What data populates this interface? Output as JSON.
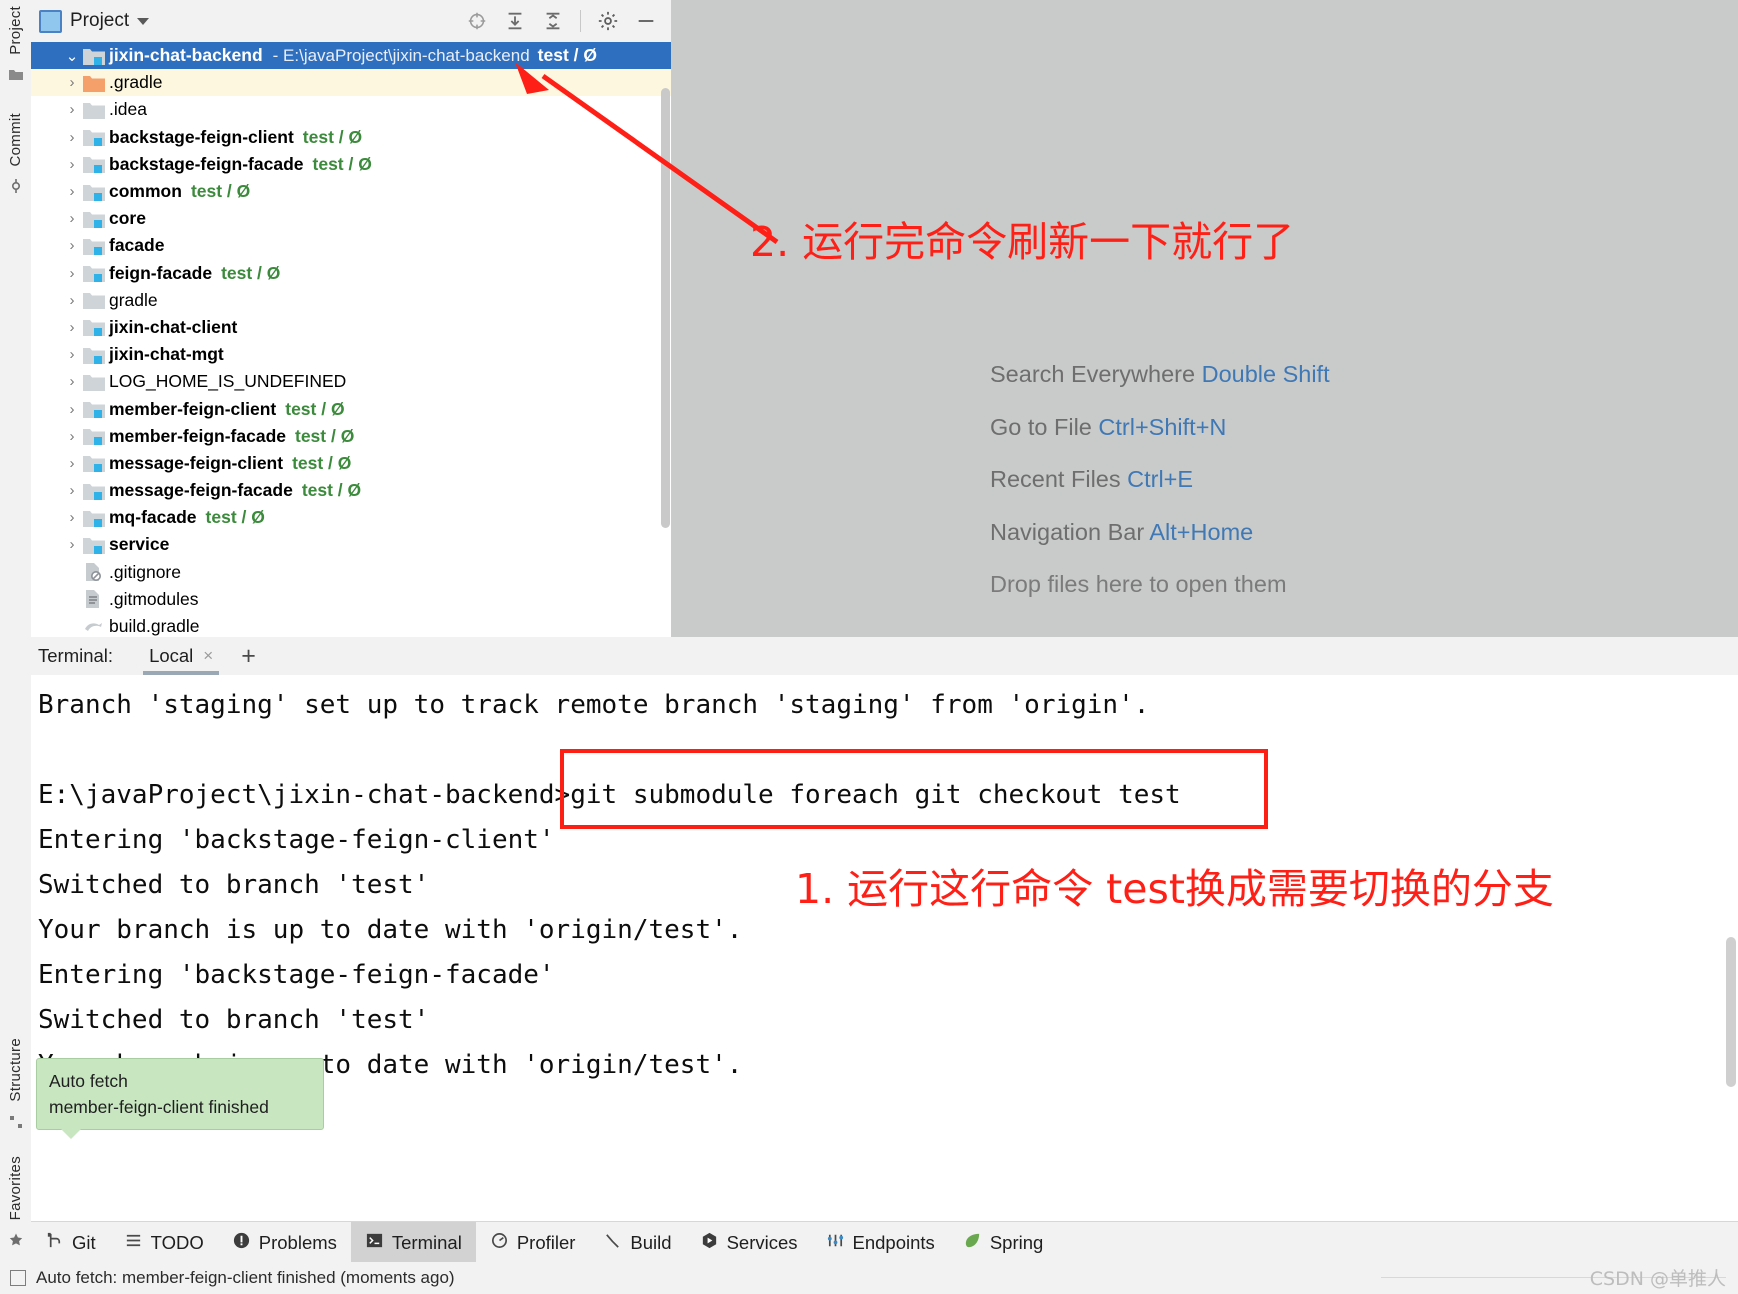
{
  "window": {
    "close_label": "×"
  },
  "left_strip": {
    "tabs": [
      {
        "label": "Project",
        "icon": "project-icon"
      },
      {
        "label": "Commit",
        "icon": "commit-icon"
      },
      {
        "label": "Structure",
        "icon": "structure-icon"
      },
      {
        "label": "Favorites",
        "icon": "star-icon"
      }
    ]
  },
  "project_panel": {
    "title": "Project",
    "icons": {
      "locate": "crosshair-icon",
      "expand_all": "expand-all-icon",
      "collapse_all": "collapse-all-icon",
      "settings": "gear-icon",
      "hide": "minimize-icon"
    },
    "root": {
      "name": "jixin-chat-backend",
      "path": "- E:\\javaProject\\jixin-chat-backend",
      "branch": "test / Ø"
    },
    "items": [
      {
        "name": ".gradle",
        "branch": "",
        "bold": false,
        "icon": "folder-orange",
        "expandable": true,
        "highlight": true
      },
      {
        "name": ".idea",
        "branch": "",
        "bold": false,
        "icon": "folder-gray",
        "expandable": true,
        "highlight": false
      },
      {
        "name": "backstage-feign-client",
        "branch": "test / Ø",
        "bold": true,
        "icon": "folder-module",
        "expandable": true,
        "highlight": false
      },
      {
        "name": "backstage-feign-facade",
        "branch": "test / Ø",
        "bold": true,
        "icon": "folder-module",
        "expandable": true,
        "highlight": false
      },
      {
        "name": "common",
        "branch": "test / Ø",
        "bold": true,
        "icon": "folder-module",
        "expandable": true,
        "highlight": false
      },
      {
        "name": "core",
        "branch": "",
        "bold": true,
        "icon": "folder-module",
        "expandable": true,
        "highlight": false
      },
      {
        "name": "facade",
        "branch": "",
        "bold": true,
        "icon": "folder-module",
        "expandable": true,
        "highlight": false
      },
      {
        "name": "feign-facade",
        "branch": "test / Ø",
        "bold": true,
        "icon": "folder-module",
        "expandable": true,
        "highlight": false
      },
      {
        "name": "gradle",
        "branch": "",
        "bold": false,
        "icon": "folder-gray",
        "expandable": true,
        "highlight": false
      },
      {
        "name": "jixin-chat-client",
        "branch": "",
        "bold": true,
        "icon": "folder-module",
        "expandable": true,
        "highlight": false
      },
      {
        "name": "jixin-chat-mgt",
        "branch": "",
        "bold": true,
        "icon": "folder-module",
        "expandable": true,
        "highlight": false
      },
      {
        "name": "LOG_HOME_IS_UNDEFINED",
        "branch": "",
        "bold": false,
        "icon": "folder-gray",
        "expandable": true,
        "highlight": false
      },
      {
        "name": "member-feign-client",
        "branch": "test / Ø",
        "bold": true,
        "icon": "folder-module",
        "expandable": true,
        "highlight": false
      },
      {
        "name": "member-feign-facade",
        "branch": "test / Ø",
        "bold": true,
        "icon": "folder-module",
        "expandable": true,
        "highlight": false
      },
      {
        "name": "message-feign-client",
        "branch": "test / Ø",
        "bold": true,
        "icon": "folder-module",
        "expandable": true,
        "highlight": false
      },
      {
        "name": "message-feign-facade",
        "branch": "test / Ø",
        "bold": true,
        "icon": "folder-module",
        "expandable": true,
        "highlight": false
      },
      {
        "name": "mq-facade",
        "branch": "test / Ø",
        "bold": true,
        "icon": "folder-module",
        "expandable": true,
        "highlight": false
      },
      {
        "name": "service",
        "branch": "",
        "bold": true,
        "icon": "folder-module",
        "expandable": true,
        "highlight": false
      },
      {
        "name": ".gitignore",
        "branch": "",
        "bold": false,
        "icon": "file-ignored",
        "expandable": false,
        "highlight": false
      },
      {
        "name": ".gitmodules",
        "branch": "",
        "bold": false,
        "icon": "file-text",
        "expandable": false,
        "highlight": false
      },
      {
        "name": "build.gradle",
        "branch": "",
        "bold": false,
        "icon": "file-gradle",
        "expandable": false,
        "highlight": false
      }
    ]
  },
  "editor": {
    "hints": [
      {
        "text": "Search Everywhere ",
        "key": "Double Shift"
      },
      {
        "text": "Go to File ",
        "key": "Ctrl+Shift+N"
      },
      {
        "text": "Recent Files ",
        "key": "Ctrl+E"
      },
      {
        "text": "Navigation Bar ",
        "key": "Alt+Home"
      }
    ],
    "drop_hint": "Drop files here to open them"
  },
  "annotations": {
    "note2": "2. 运行完命令刷新一下就行了",
    "note1": "1. 运行这行命令 test换成需要切换的分支",
    "color": "#fe2016"
  },
  "terminal": {
    "label": "Terminal:",
    "tab": "Local",
    "close": "×",
    "add": "+",
    "lines": [
      "Branch 'staging' set up to track remote branch 'staging' from 'origin'.",
      "",
      "E:\\javaProject\\jixin-chat-backend>git submodule foreach git checkout test",
      "Entering 'backstage-feign-client'",
      "Switched to branch 'test'",
      "Your branch is up to date with 'origin/test'.",
      "Entering 'backstage-feign-facade'",
      "Switched to branch 'test'",
      "Your branch is up to date with 'origin/test'."
    ]
  },
  "tooltip": {
    "title": "Auto fetch",
    "body": "member-feign-client finished"
  },
  "bottom_bar": {
    "items": [
      {
        "label": "Git",
        "icon": "git-branch-icon",
        "active": false
      },
      {
        "label": "TODO",
        "icon": "list-icon",
        "active": false
      },
      {
        "label": "Problems",
        "icon": "warning-icon",
        "active": false
      },
      {
        "label": "Terminal",
        "icon": "terminal-icon",
        "active": true
      },
      {
        "label": "Profiler",
        "icon": "profiler-icon",
        "active": false
      },
      {
        "label": "Build",
        "icon": "hammer-icon",
        "active": false
      },
      {
        "label": "Services",
        "icon": "services-icon",
        "active": false
      },
      {
        "label": "Endpoints",
        "icon": "endpoints-icon",
        "active": false
      },
      {
        "label": "Spring",
        "icon": "spring-leaf-icon",
        "active": false
      }
    ]
  },
  "status_bar": {
    "message": "Auto fetch: member-feign-client finished (moments ago)"
  },
  "watermark": {
    "text": "CSDN @单推人"
  }
}
